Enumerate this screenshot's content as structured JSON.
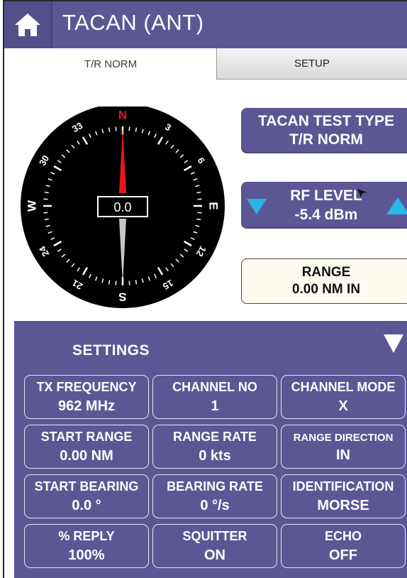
{
  "header": {
    "title": "TACAN (ANT)",
    "home_icon": "home-icon"
  },
  "tabs": [
    {
      "label": "T/R NORM",
      "active": true
    },
    {
      "label": "SETUP",
      "active": false
    }
  ],
  "compass": {
    "bearing_value": "0.0",
    "labels": [
      "N",
      "3",
      "6",
      "E",
      "12",
      "15",
      "S",
      "21",
      "24",
      "W",
      "30",
      "33"
    ],
    "needle_colors": {
      "north": "#e8141b",
      "south": "#c8c8c8"
    }
  },
  "tacan_test_type": {
    "label": "TACAN TEST TYPE",
    "value": "T/R NORM"
  },
  "rf_level": {
    "label": "RF LEVEL",
    "value": "-5.4 dBm",
    "down_icon": "arrow-down-icon",
    "up_icon": "arrow-up-icon"
  },
  "range": {
    "label": "RANGE",
    "value": "0.00 NM IN"
  },
  "settings": {
    "title": "SETTINGS",
    "toggle_icon": "chevron-down-icon",
    "cells": [
      {
        "label": "TX FREQUENCY",
        "value": "962 MHz"
      },
      {
        "label": "CHANNEL NO",
        "value": "1"
      },
      {
        "label": "CHANNEL MODE",
        "value": "X"
      },
      {
        "label": "START RANGE",
        "value": "0.00 NM"
      },
      {
        "label": "RANGE RATE",
        "value": "0 kts"
      },
      {
        "label": "RANGE DIRECTION",
        "value": "IN"
      },
      {
        "label": "START BEARING",
        "value": "0.0 °"
      },
      {
        "label": "BEARING RATE",
        "value": "0 °/s"
      },
      {
        "label": "IDENTIFICATION",
        "value": "MORSE"
      },
      {
        "label": "% REPLY",
        "value": "100%"
      },
      {
        "label": "SQUITTER",
        "value": "ON"
      },
      {
        "label": "ECHO",
        "value": "OFF"
      }
    ]
  },
  "colors": {
    "accent": "#5d5695",
    "arrow": "#29b6e8",
    "range_bg": "#fdfbf0"
  }
}
